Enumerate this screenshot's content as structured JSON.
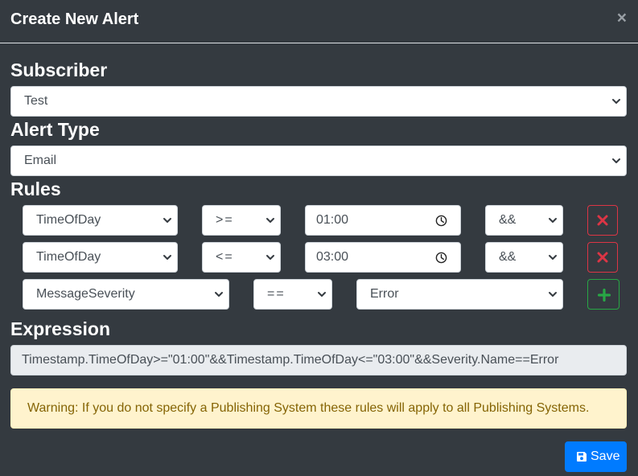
{
  "modal": {
    "title": "Create New Alert",
    "close_symbol": "×"
  },
  "subscriber": {
    "label": "Subscriber",
    "value": "Test"
  },
  "alert_type": {
    "label": "Alert Type",
    "value": "Email"
  },
  "rules": {
    "label": "Rules",
    "rows": [
      {
        "field": "TimeOfDay",
        "operator": ">=",
        "value": "01:00",
        "joiner": "&&",
        "action": "remove"
      },
      {
        "field": "TimeOfDay",
        "operator": "<=",
        "value": "03:00",
        "joiner": "&&",
        "action": "remove"
      },
      {
        "field": "MessageSeverity",
        "operator": "==",
        "value": "Error",
        "action": "add"
      }
    ]
  },
  "expression": {
    "label": "Expression",
    "value": "Timestamp.TimeOfDay>=\"01:00\"&&Timestamp.TimeOfDay<=\"03:00\"&&Severity.Name==Error"
  },
  "warning": {
    "text": "Warning: If you do not specify a Publishing System these rules will apply to all Publishing Systems."
  },
  "footer": {
    "save_label": "Save"
  },
  "icons": {
    "close": "close-icon",
    "chevron": "chevron-down-icon",
    "clock": "clock-icon",
    "remove": "times-icon",
    "add": "plus-icon",
    "save": "floppy-disk-icon"
  },
  "colors": {
    "background": "#343a40",
    "danger": "#dc3545",
    "success": "#28a745",
    "primary": "#007bff",
    "warning_bg": "#fff3cd",
    "warning_text": "#856404"
  }
}
